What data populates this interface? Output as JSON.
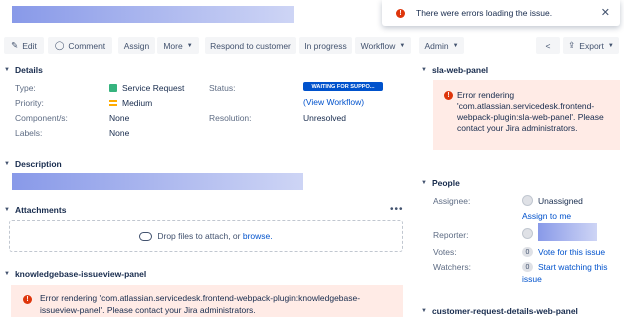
{
  "toast": {
    "message": "There were errors loading the issue.",
    "close": "✕"
  },
  "toolbar": {
    "edit": "Edit",
    "comment": "Comment",
    "assign": "Assign",
    "more": "More",
    "respond": "Respond to customer",
    "in_progress": "In progress",
    "workflow": "Workflow",
    "admin": "Admin",
    "export": "Export"
  },
  "details": {
    "heading": "Details",
    "type_label": "Type:",
    "type_value": "Service Request",
    "priority_label": "Priority:",
    "priority_value": "Medium",
    "components_label": "Component/s:",
    "components_value": "None",
    "labels_label": "Labels:",
    "labels_value": "None",
    "status_label": "Status:",
    "status_value": "WAITING FOR SUPPO...",
    "view_workflow": "(View Workflow)",
    "resolution_label": "Resolution:",
    "resolution_value": "Unresolved"
  },
  "description": {
    "heading": "Description"
  },
  "attachments": {
    "heading": "Attachments",
    "more": "•••",
    "drop_text": "Drop files to attach, or",
    "browse": "browse."
  },
  "kb_panel": {
    "heading": "knowledgebase-issueview-panel",
    "error_line1": "Error rendering 'com.atlassian.servicedesk.frontend-webpack-plugin:knowledgebase-",
    "error_line2": "issueview-panel'. Please contact your Jira administrators."
  },
  "sla_panel": {
    "heading": "sla-web-panel",
    "error_lines": [
      "Error rendering",
      "'com.atlassian.servicedesk.frontend-",
      "webpack-plugin:sla-web-panel'. Please",
      "contact your Jira administrators."
    ]
  },
  "people": {
    "heading": "People",
    "assignee_label": "Assignee:",
    "assignee_value": "Unassigned",
    "assign_to_me": "Assign to me",
    "reporter_label": "Reporter:",
    "votes_label": "Votes:",
    "votes_count": "0",
    "vote_link": "Vote for this issue",
    "watchers_label": "Watchers:",
    "watchers_count": "0",
    "watch_link_1": "Start watching this",
    "watch_link_2": "issue"
  },
  "crd_panel": {
    "heading": "customer-request-details-web-panel"
  }
}
